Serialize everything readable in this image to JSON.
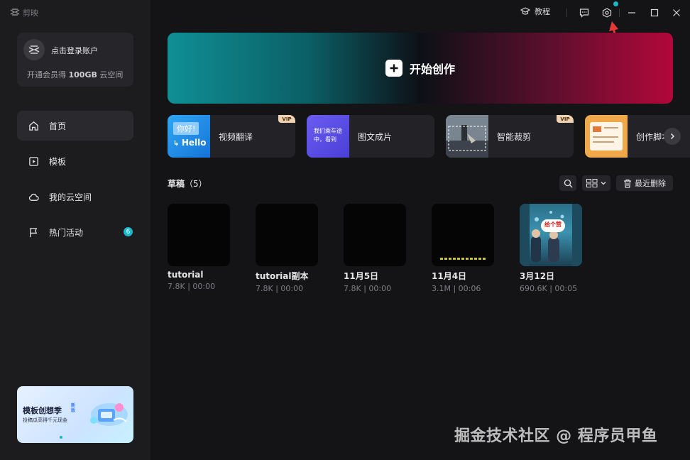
{
  "app": {
    "logo_text": "剪映"
  },
  "topbar": {
    "tutorial_label": "教程"
  },
  "account": {
    "avatar_initial": "✕",
    "login_label": "点击登录账户",
    "vip_prefix": "开通会员得 ",
    "vip_highlight": "100GB",
    "vip_suffix": " 云空间"
  },
  "sidebar": {
    "items": [
      {
        "label": "首页"
      },
      {
        "label": "模板"
      },
      {
        "label": "我的云空间"
      },
      {
        "label": "热门活动",
        "badge": "6"
      }
    ],
    "promo": {
      "title": "模板创想季",
      "tag_line1": "新",
      "tag_line2": "版",
      "subtitle": "投稿瓜高得千元现金"
    }
  },
  "hero": {
    "label": "开始创作"
  },
  "tools": [
    {
      "label": "视频翻译",
      "thumb_line1": "你好!",
      "thumb_line2": "Hello",
      "vip": "VIP"
    },
    {
      "label": "图文成片",
      "thumb_line1": "我们乘车途",
      "thumb_line2": "中，看到"
    },
    {
      "label": "智能裁剪",
      "vip": "VIP"
    },
    {
      "label": "创作脚本"
    }
  ],
  "drafts": {
    "title": "草稿",
    "count": "（5）",
    "recent_delete_label": "最近删除",
    "items": [
      {
        "name": "tutorial",
        "meta": "7.8K | 00:00"
      },
      {
        "name": "tutorial副本",
        "meta": "7.8K | 00:00"
      },
      {
        "name": "11月5日",
        "meta": "7.8K | 00:00"
      },
      {
        "name": "11月4日",
        "meta": "3.1M | 00:06"
      },
      {
        "name": "3月12日",
        "meta": "690.6K | 00:05",
        "thumb_sign": "给个赞"
      }
    ]
  },
  "watermark": "掘金技术社区 @ 程序员甲鱼",
  "colors": {
    "accent": "#1bb8c9",
    "hero_left": "#0f8f95",
    "hero_right": "#b3083b",
    "annotation_arrow": "#e53935"
  }
}
